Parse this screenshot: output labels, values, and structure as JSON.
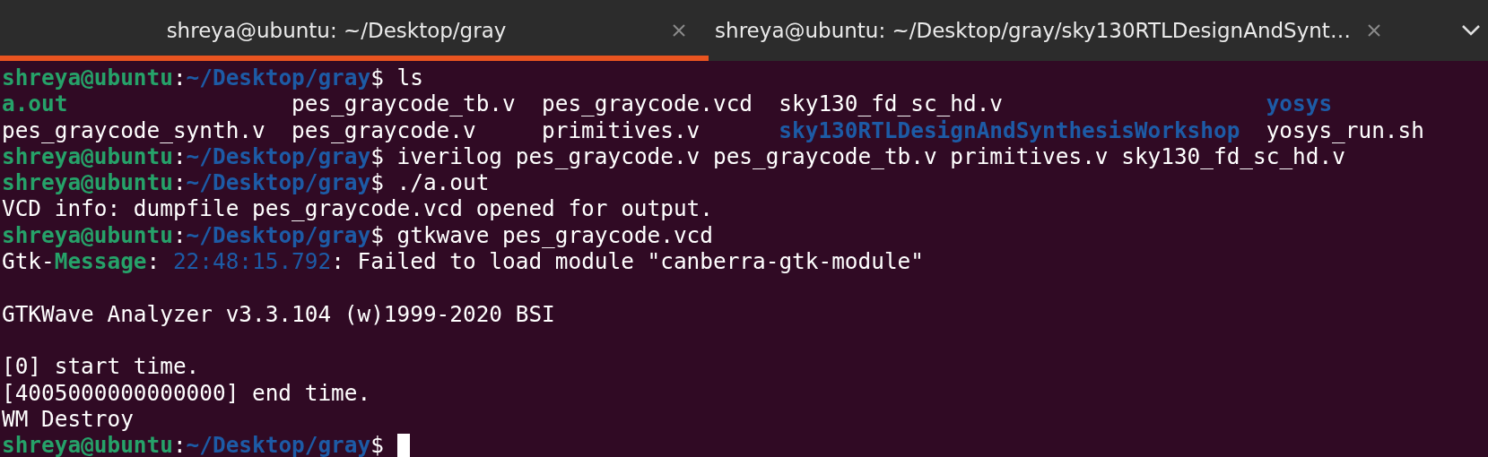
{
  "tabs": [
    {
      "title": "shreya@ubuntu: ~/Desktop/gray",
      "selected": true
    },
    {
      "title": "shreya@ubuntu: ~/Desktop/gray/sky130RTLDesignAndSynt…",
      "selected": false
    }
  ],
  "terminal": {
    "cursor": true,
    "lines": [
      {
        "kind": "segments",
        "segments": [
          {
            "text": "shreya@ubuntu",
            "kind": "user"
          },
          {
            "text": ":",
            "kind": "plain"
          },
          {
            "text": "~/Desktop/gray",
            "kind": "path"
          },
          {
            "text": "$ ls",
            "kind": "plain"
          }
        ]
      },
      {
        "kind": "listing",
        "entries": [
          {
            "name": "a.out",
            "kind": "executable"
          },
          {
            "name": "pes_graycode_tb.v",
            "kind": "file"
          },
          {
            "name": "pes_graycode.vcd",
            "kind": "file"
          },
          {
            "name": "sky130_fd_sc_hd.v",
            "kind": "file"
          },
          {
            "name": "yosys",
            "kind": "directory"
          }
        ]
      },
      {
        "kind": "listing",
        "entries": [
          {
            "name": "pes_graycode_synth.v",
            "kind": "file"
          },
          {
            "name": "pes_graycode.v",
            "kind": "file"
          },
          {
            "name": "primitives.v",
            "kind": "file"
          },
          {
            "name": "sky130RTLDesignAndSynthesisWorkshop",
            "kind": "directory"
          },
          {
            "name": "yosys_run.sh",
            "kind": "file"
          }
        ]
      },
      {
        "kind": "segments",
        "segments": [
          {
            "text": "shreya@ubuntu",
            "kind": "user"
          },
          {
            "text": ":",
            "kind": "plain"
          },
          {
            "text": "~/Desktop/gray",
            "kind": "path"
          },
          {
            "text": "$ iverilog pes_graycode.v pes_graycode_tb.v primitives.v sky130_fd_sc_hd.v",
            "kind": "plain"
          }
        ]
      },
      {
        "kind": "segments",
        "segments": [
          {
            "text": "shreya@ubuntu",
            "kind": "user"
          },
          {
            "text": ":",
            "kind": "plain"
          },
          {
            "text": "~/Desktop/gray",
            "kind": "path"
          },
          {
            "text": "$ ./a.out",
            "kind": "plain"
          }
        ]
      },
      {
        "kind": "segments",
        "segments": [
          {
            "text": "VCD info: dumpfile pes_graycode.vcd opened for output.",
            "kind": "plain"
          }
        ]
      },
      {
        "kind": "segments",
        "segments": [
          {
            "text": "shreya@ubuntu",
            "kind": "user"
          },
          {
            "text": ":",
            "kind": "plain"
          },
          {
            "text": "~/Desktop/gray",
            "kind": "path"
          },
          {
            "text": "$ gtkwave pes_graycode.vcd",
            "kind": "plain"
          }
        ]
      },
      {
        "kind": "segments",
        "segments": [
          {
            "text": "Gtk-",
            "kind": "plain"
          },
          {
            "text": "Message",
            "kind": "user"
          },
          {
            "text": ": ",
            "kind": "plain"
          },
          {
            "text": "22:48:15.792",
            "kind": "time"
          },
          {
            "text": ": Failed to load module \"canberra-gtk-module\"",
            "kind": "plain"
          }
        ]
      },
      {
        "kind": "blank"
      },
      {
        "kind": "segments",
        "segments": [
          {
            "text": "GTKWave Analyzer v3.3.104 (w)1999-2020 BSI",
            "kind": "plain"
          }
        ]
      },
      {
        "kind": "blank"
      },
      {
        "kind": "segments",
        "segments": [
          {
            "text": "[0] start time.",
            "kind": "plain"
          }
        ]
      },
      {
        "kind": "segments",
        "segments": [
          {
            "text": "[4005000000000000] end time.",
            "kind": "plain"
          }
        ]
      },
      {
        "kind": "segments",
        "segments": [
          {
            "text": "WM Destroy",
            "kind": "plain"
          }
        ]
      },
      {
        "kind": "segments",
        "segments": [
          {
            "text": "shreya@ubuntu",
            "kind": "user"
          },
          {
            "text": ":",
            "kind": "plain"
          },
          {
            "text": "~/Desktop/gray",
            "kind": "path"
          },
          {
            "text": "$ ",
            "kind": "plain"
          }
        ]
      }
    ]
  }
}
